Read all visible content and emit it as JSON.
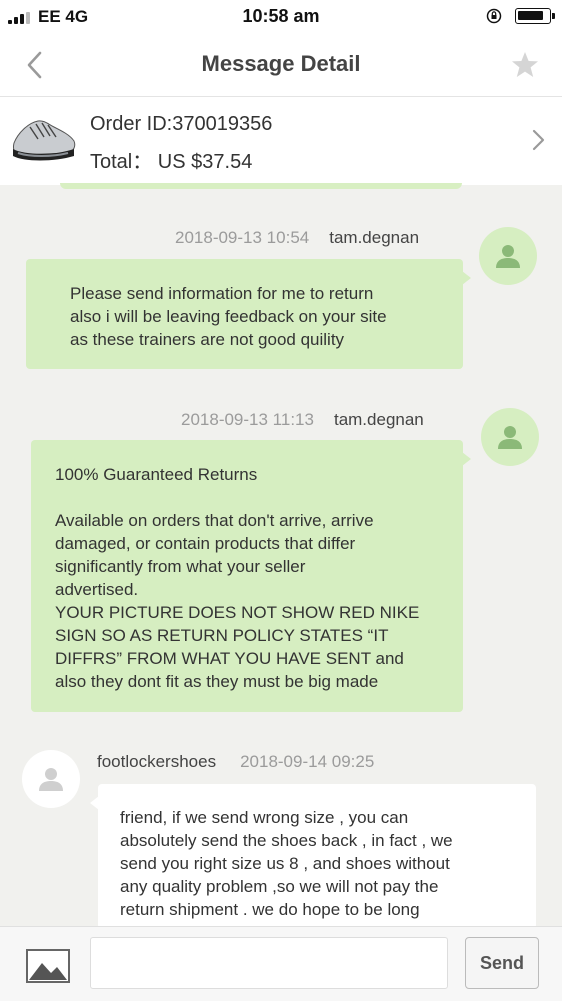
{
  "status_bar": {
    "carrier": "EE  4G",
    "time": "10:58 am"
  },
  "header": {
    "title": "Message Detail"
  },
  "order": {
    "id": "Order ID:370019356",
    "total": "Total： US $37.54"
  },
  "messages": [
    {
      "timestamp": "2018-09-13 10:54",
      "user": "tam.degnan",
      "lines": [
        "Please send information for me to return",
        "also i will be leaving feedback on your site",
        "as these trainers are not good quility"
      ]
    },
    {
      "timestamp": "2018-09-13 11:13",
      "user": "tam.degnan",
      "lines": [
        "100% Guaranteed Returns",
        "",
        "Available on orders that don't arrive, arrive",
        "damaged, or contain products that differ",
        "significantly from what your seller",
        "advertised.",
        "YOUR PICTURE DOES NOT SHOW RED NIKE",
        "SIGN SO AS RETURN POLICY STATES “IT",
        "DIFFRS” FROM WHAT YOU HAVE SENT and",
        "also they dont fit as they must be big made"
      ]
    },
    {
      "timestamp": "2018-09-14 09:25",
      "user": "footlockershoes",
      "lines": [
        "friend, if we send wrong size , you can",
        "absolutely send the shoes back , in fact , we",
        "send you right size us 8 , and shoes without",
        "any quality problem ,so we will not pay the",
        "return shipment . we do hope to be long"
      ]
    }
  ],
  "compose": {
    "placeholder": "",
    "send_label": "Send"
  },
  "colors": {
    "bubble_green": "#d6eec1",
    "avatar_icon_green": "#8bb978",
    "background": "#f1f1ee"
  },
  "icons": [
    "signal-icon",
    "lock-rotation-icon",
    "battery-icon",
    "back-chevron-icon",
    "star-icon",
    "shoe-product-image",
    "chevron-right-icon",
    "user-avatar-icon",
    "image-icon"
  ]
}
